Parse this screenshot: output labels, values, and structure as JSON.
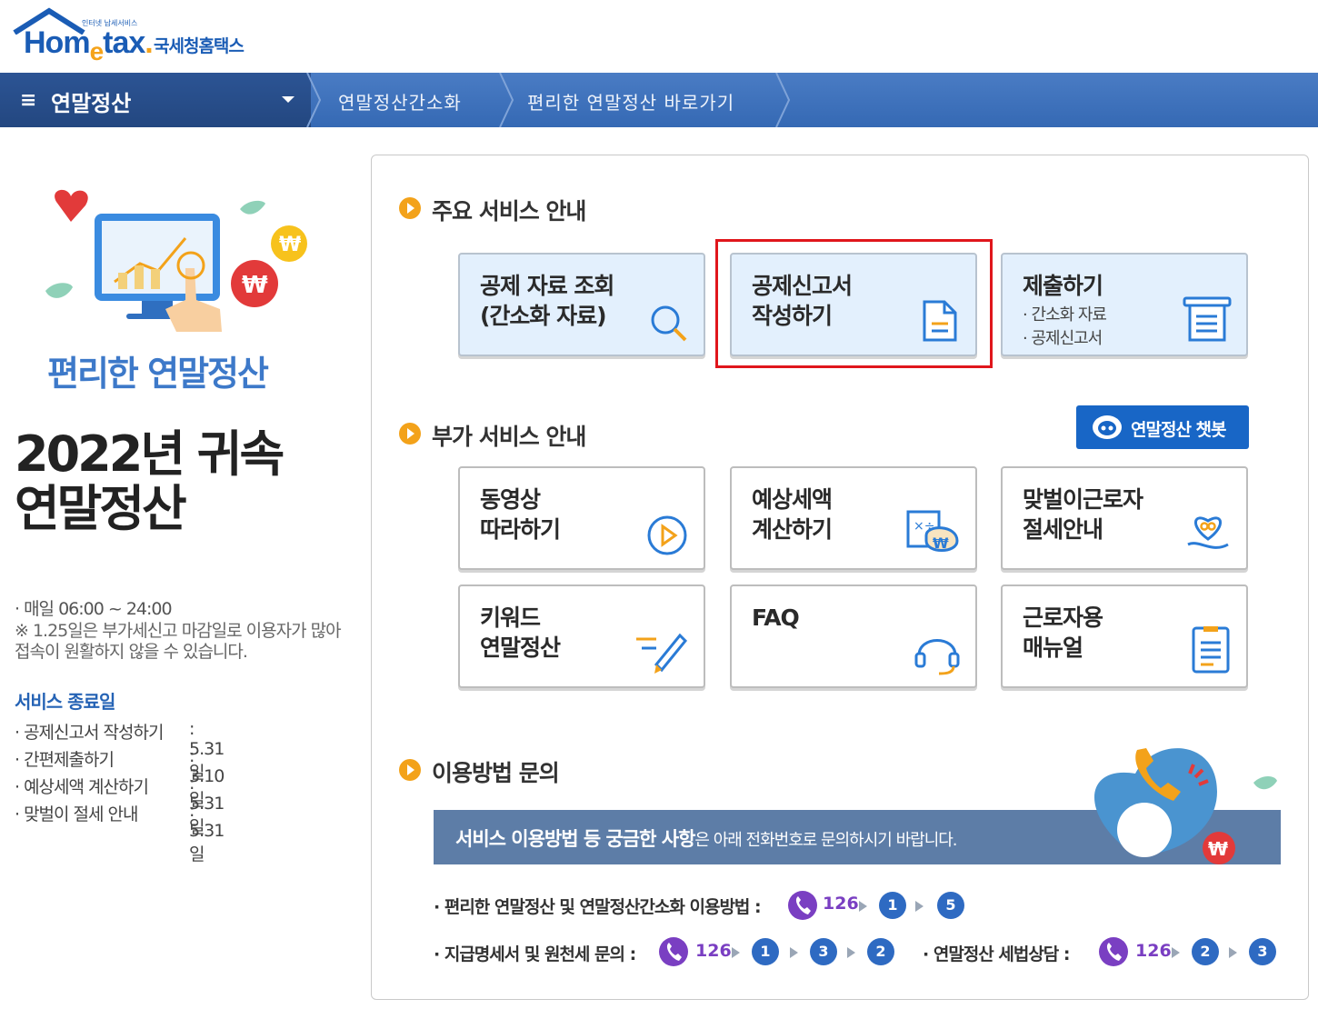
{
  "header": {
    "logo_brand": "Hometax",
    "logo_kr": "국세청홈택스",
    "logo_tagline": "인터넷 납세서비스"
  },
  "nav": {
    "menu_title": "연말정산",
    "crumbs": [
      "연말정산간소화",
      "편리한 연말정산 바로가기"
    ]
  },
  "left": {
    "promo_title": "편리한 연말정산",
    "year_title_1": "2022년 귀속",
    "year_title_2": "연말정산",
    "hours": "· 매일 06:00  ~ 24:00",
    "notice": "※ 1.25일은 부가세신고 마감일로 이용자가 많아 접속이 원활하지 않을 수 있습니다.",
    "end_title": "서비스 종료일",
    "end_items": [
      {
        "label": "· 공제신고서 작성하기",
        "date": ": 5.31일"
      },
      {
        "label": "· 간편제출하기",
        "date": ": 3.10일"
      },
      {
        "label": "· 예상세액 계산하기",
        "date": ": 5.31일"
      },
      {
        "label": "· 맞벌이 절세 안내",
        "date": ": 5.31일"
      }
    ]
  },
  "main_services": {
    "title": "주요 서비스 안내",
    "cards": [
      {
        "label": "공제 자료 조회\n(간소화 자료)",
        "icon": "search-icon"
      },
      {
        "label": "공제신고서\n작성하기",
        "icon": "document-icon"
      },
      {
        "label": "제출하기",
        "sub1": "· 간소화 자료",
        "sub2": "· 공제신고서",
        "icon": "submit-tray-icon"
      }
    ]
  },
  "extra_services": {
    "title": "부가 서비스 안내",
    "chatbot_label": "연말정산 챗봇",
    "cards": [
      {
        "label": "동영상\n따라하기",
        "icon": "play-icon"
      },
      {
        "label": "예상세액\n계산하기",
        "icon": "calculator-money-icon"
      },
      {
        "label": "맞벌이근로자\n절세안내",
        "icon": "heart-hand-icon"
      },
      {
        "label": "키워드\n연말정산",
        "icon": "pencil-icon"
      },
      {
        "label": "FAQ",
        "icon": "headset-icon"
      },
      {
        "label": "근로자용\n매뉴얼",
        "icon": "manual-icon"
      }
    ]
  },
  "inquiry": {
    "title": "이용방법 문의",
    "banner_bold": "서비스 이용방법 등 궁금한 사항",
    "banner_rest": "은 아래 전화번호로 문의하시기 바랍니다.",
    "line1_label": "· 편리한 연말정산 및 연말정산간소화 이용방법 :",
    "line1_steps": [
      "1",
      "5"
    ],
    "line2_label": "· 지급명세서 및 원천세 문의 :",
    "line2_steps": [
      "1",
      "3",
      "2"
    ],
    "line3_label": "· 연말정산 세법상담  :",
    "line3_steps": [
      "2",
      "3"
    ],
    "phone_number": "126"
  },
  "colors": {
    "nav_bg": "#3569b4",
    "nav_main_bg": "#234780",
    "accent_orange": "#f3a21a",
    "chatbot_blue": "#1866c6",
    "highlight_red": "#e0161c",
    "phone_purple": "#7a3fc2"
  }
}
